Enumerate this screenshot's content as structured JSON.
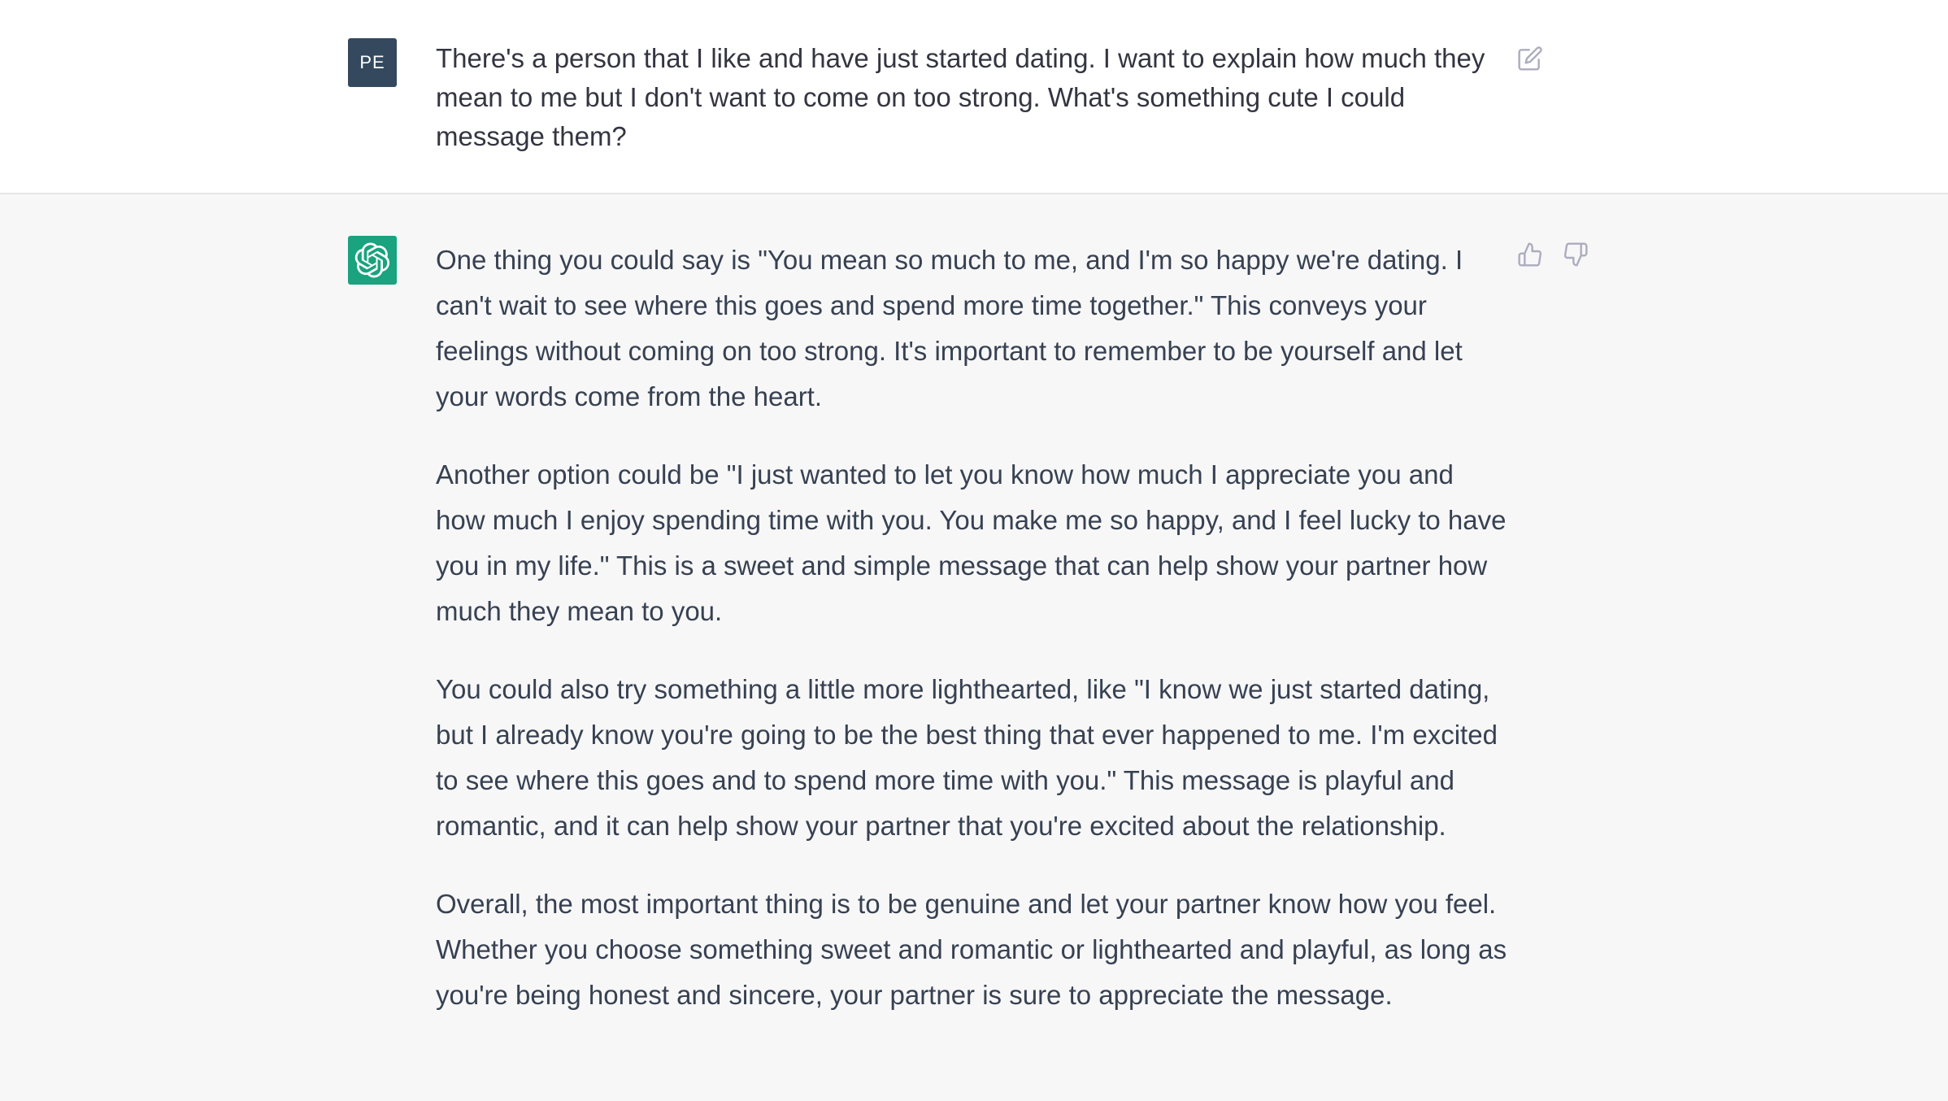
{
  "user_message": {
    "avatar_initials": "PE",
    "avatar_color": "#34495e",
    "text": "There's a person that I like and have just started dating. I want to explain how much they mean to me but I don't want to come on too strong. What's something cute I could message them?",
    "edit_icon": "edit-icon"
  },
  "assistant_message": {
    "avatar_icon": "openai-logo-icon",
    "avatar_color": "#19a37f",
    "paragraphs": [
      "One thing you could say is \"You mean so much to me, and I'm so happy we're dating. I can't wait to see where this goes and spend more time together.\" This conveys your feelings without coming on too strong. It's important to remember to be yourself and let your words come from the heart.",
      "Another option could be \"I just wanted to let you know how much I appreciate you and how much I enjoy spending time with you. You make me so happy, and I feel lucky to have you in my life.\" This is a sweet and simple message that can help show your partner how much they mean to you.",
      "You could also try something a little more lighthearted, like \"I know we just started dating, but I already know you're going to be the best thing that ever happened to me. I'm excited to see where this goes and to spend more time with you.\" This message is playful and romantic, and it can help show your partner that you're excited about the relationship.",
      "Overall, the most important thing is to be genuine and let your partner know how you feel. Whether you choose something sweet and romantic or lighthearted and playful, as long as you're being honest and sincere, your partner is sure to appreciate the message."
    ],
    "feedback_icons": [
      "thumbs-up-icon",
      "thumbs-down-icon"
    ]
  }
}
